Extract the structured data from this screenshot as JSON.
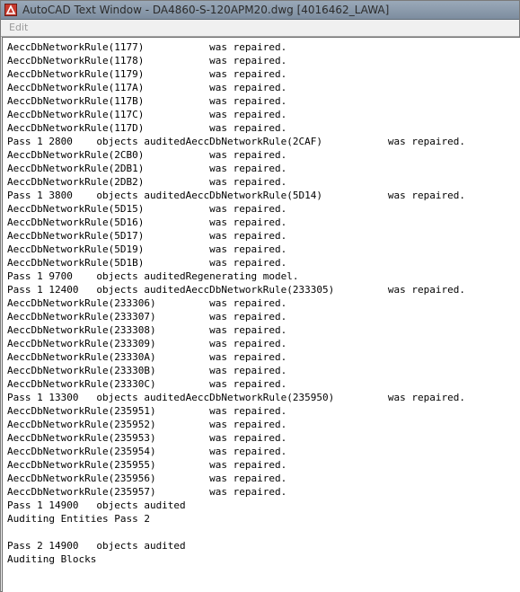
{
  "window": {
    "title": "AutoCAD Text Window - DA4860-S-120APM20.dwg [4016462_LAWA]"
  },
  "menu": {
    "edit_label": "Edit"
  },
  "console": {
    "lines": [
      "AeccDbNetworkRule(1177)           was repaired.",
      "AeccDbNetworkRule(1178)           was repaired.",
      "AeccDbNetworkRule(1179)           was repaired.",
      "AeccDbNetworkRule(117A)           was repaired.",
      "AeccDbNetworkRule(117B)           was repaired.",
      "AeccDbNetworkRule(117C)           was repaired.",
      "AeccDbNetworkRule(117D)           was repaired.",
      "Pass 1 2800    objects auditedAeccDbNetworkRule(2CAF)           was repaired.",
      "AeccDbNetworkRule(2CB0)           was repaired.",
      "AeccDbNetworkRule(2DB1)           was repaired.",
      "AeccDbNetworkRule(2DB2)           was repaired.",
      "Pass 1 3800    objects auditedAeccDbNetworkRule(5D14)           was repaired.",
      "AeccDbNetworkRule(5D15)           was repaired.",
      "AeccDbNetworkRule(5D16)           was repaired.",
      "AeccDbNetworkRule(5D17)           was repaired.",
      "AeccDbNetworkRule(5D19)           was repaired.",
      "AeccDbNetworkRule(5D1B)           was repaired.",
      "Pass 1 9700    objects auditedRegenerating model.",
      "Pass 1 12400   objects auditedAeccDbNetworkRule(233305)         was repaired.",
      "AeccDbNetworkRule(233306)         was repaired.",
      "AeccDbNetworkRule(233307)         was repaired.",
      "AeccDbNetworkRule(233308)         was repaired.",
      "AeccDbNetworkRule(233309)         was repaired.",
      "AeccDbNetworkRule(23330A)         was repaired.",
      "AeccDbNetworkRule(23330B)         was repaired.",
      "AeccDbNetworkRule(23330C)         was repaired.",
      "Pass 1 13300   objects auditedAeccDbNetworkRule(235950)         was repaired.",
      "AeccDbNetworkRule(235951)         was repaired.",
      "AeccDbNetworkRule(235952)         was repaired.",
      "AeccDbNetworkRule(235953)         was repaired.",
      "AeccDbNetworkRule(235954)         was repaired.",
      "AeccDbNetworkRule(235955)         was repaired.",
      "AeccDbNetworkRule(235956)         was repaired.",
      "AeccDbNetworkRule(235957)         was repaired.",
      "Pass 1 14900   objects audited",
      "Auditing Entities Pass 2",
      "",
      "Pass 2 14900   objects audited",
      "Auditing Blocks"
    ]
  }
}
